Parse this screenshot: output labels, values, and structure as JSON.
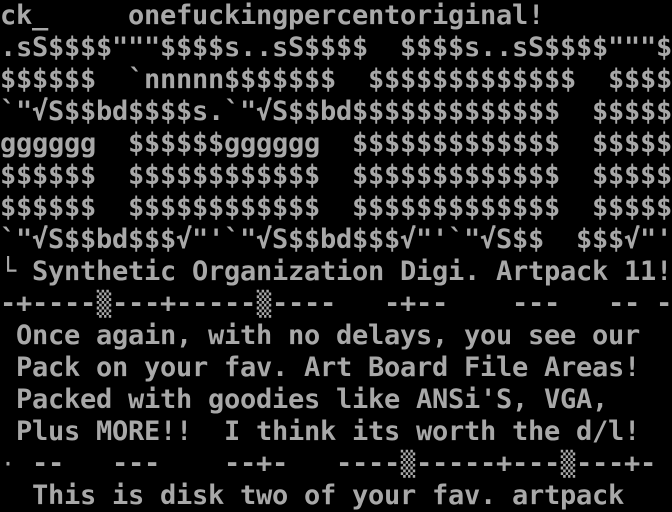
{
  "terminal": {
    "background": "#000000",
    "foreground": "#a8a8a8",
    "columns": 42,
    "rows": 16
  },
  "header": {
    "line": "ck_     onefuckingpercentoriginal!"
  },
  "ascii_art": {
    "lines": [
      ".sS$$$$\"\"\"$$$$s..sS$$$$  $$$$s..sS$$$$\"\"\"$$$$s.",
      "$$$$$$  `nnnnn$$$$$$$  $$$$$$$$$$$$$  $$$$$$",
      "`\"√S$$bd$$$$s.`\"√S$$bd$$$$$$$$$$$$$  $$$$$$",
      "gggggg  $$$$$$gggggg  $$$$$$$$$$$$$  $$$$$$",
      "$$$$$$  $$$$$$$$$$$$  $$$$$$$$$$$$$  $$$$$$",
      "$$$$$$  $$$$$$$$$$$$  $$$$$$$$$$$$$  $$$$$$",
      "`\"√S$$bd$$$√\"'`\"√S$$bd$$$√\"'`\"√S$$  $$$√\"'"
    ]
  },
  "title": {
    "line": "└ Synthetic Organization Digi. Artpack 11!"
  },
  "divider_top": {
    "line": "-+----▒---+-----▒----   -+--    ---   -- -"
  },
  "body": {
    "lines": [
      " Once again, with no delays, you see our",
      " Pack on your fav. Art Board File Areas!",
      " Packed with goodies like ANSi'S, VGA,",
      " Plus MORE!!  I think its worth the d/l!"
    ]
  },
  "divider_bottom": {
    "line": "· --   ---    --+-   ----▒-----+---▒---+-"
  },
  "footer": {
    "line": "  This is disk two of your fav. artpack"
  }
}
